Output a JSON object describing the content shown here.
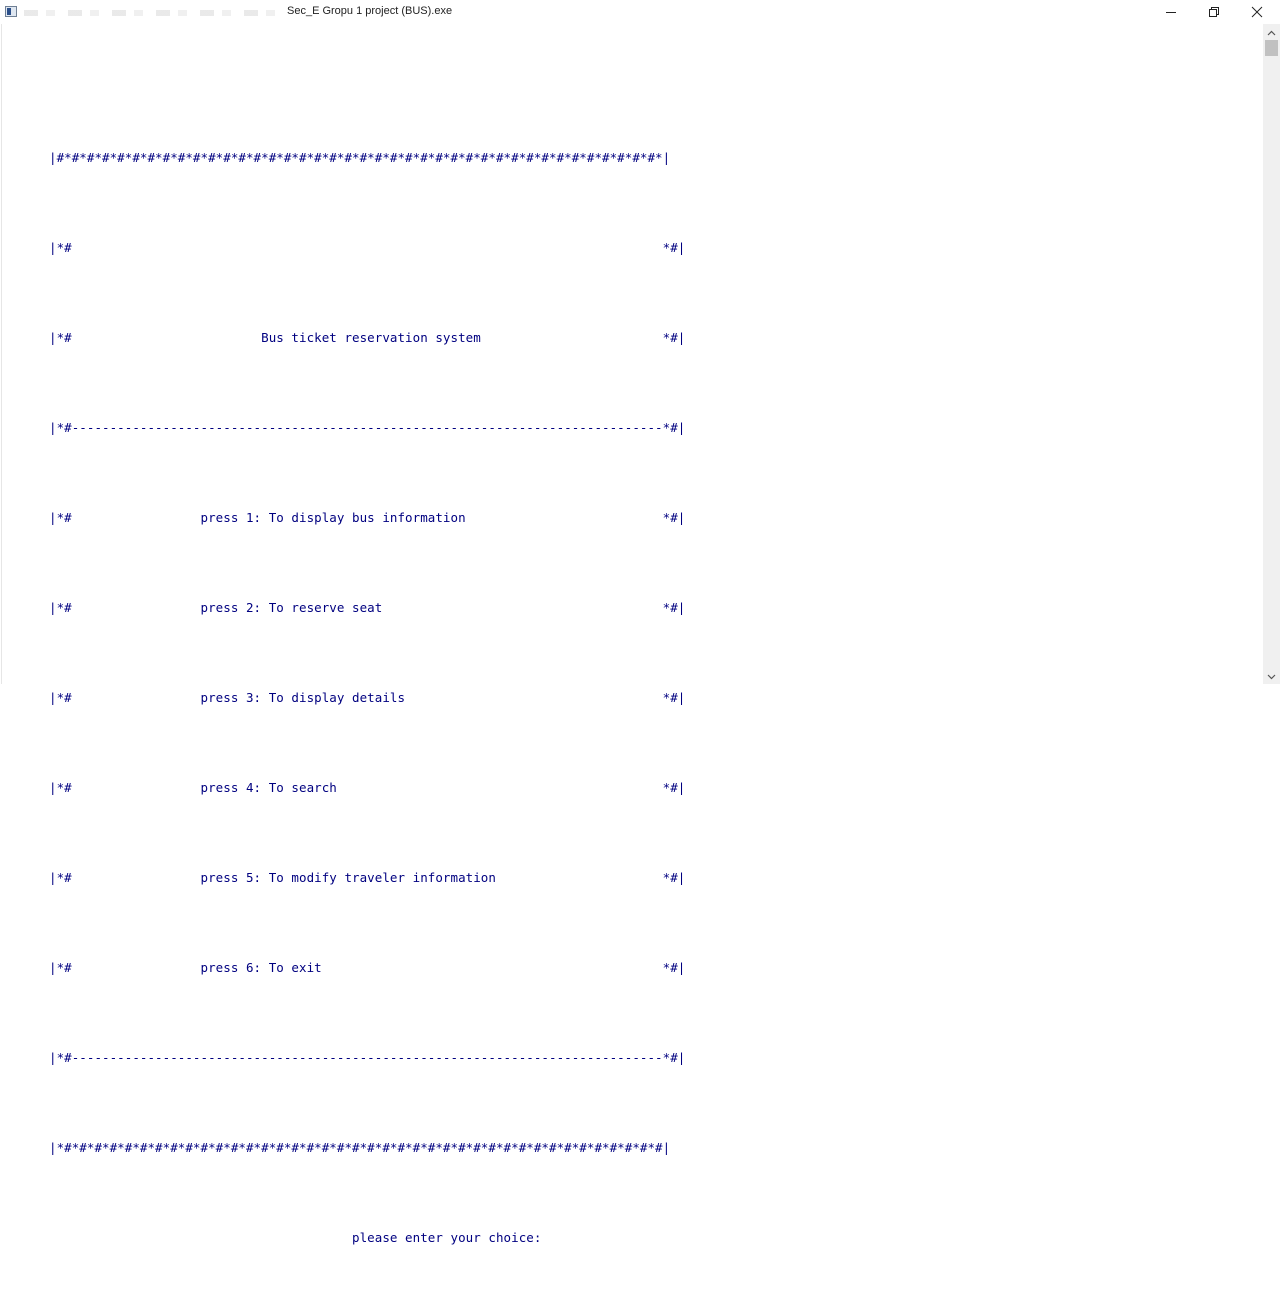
{
  "window": {
    "title": "Sec_E Gropu 1 project (BUS).exe",
    "controls": {
      "minimize_icon": "minimize-icon",
      "maximize_icon": "restore-icon",
      "close_icon": "close-icon"
    }
  },
  "console": {
    "text_color": "#000080",
    "background": "#ffffff",
    "lines": [
      "|#*#*#*#*#*#*#*#*#*#*#*#*#*#*#*#*#*#*#*#*#*#*#*#*#*#*#*#*#*#*#*#*#*#*#*#*#*#*#*#*|",
      "|*#                                                                              *#|",
      "|*#                         Bus ticket reservation system                        *#|",
      "|*#------------------------------------------------------------------------------*#|",
      "|*#                 press 1: To display bus information                          *#|",
      "|*#                 press 2: To reserve seat                                     *#|",
      "|*#                 press 3: To display details                                  *#|",
      "|*#                 press 4: To search                                           *#|",
      "|*#                 press 5: To modify traveler information                      *#|",
      "|*#                 press 6: To exit                                             *#|",
      "|*#------------------------------------------------------------------------------*#|",
      "|*#*#*#*#*#*#*#*#*#*#*#*#*#*#*#*#*#*#*#*#*#*#*#*#*#*#*#*#*#*#*#*#*#*#*#*#*#*#*#*#|",
      "                                        please enter your choice:"
    ]
  }
}
